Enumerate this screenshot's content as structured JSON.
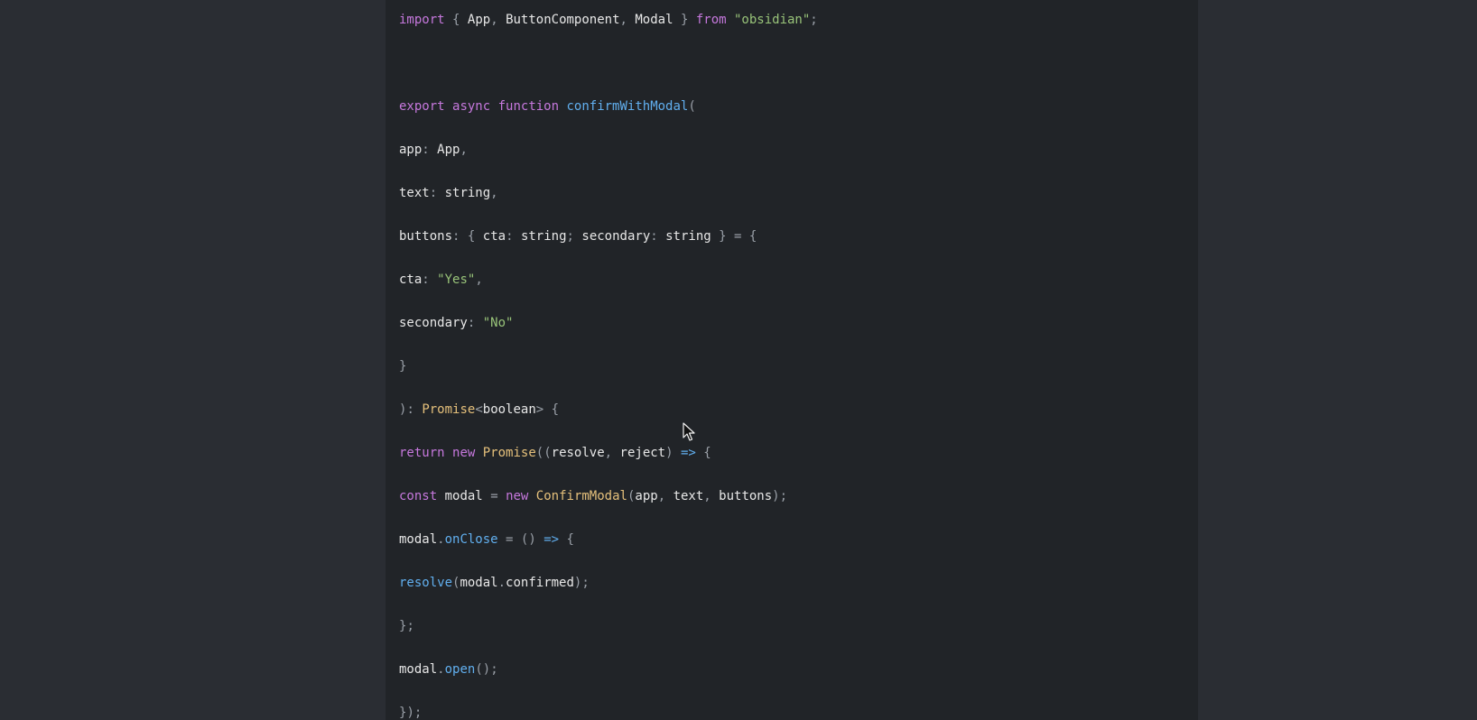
{
  "code": {
    "lines": [
      "import { App, ButtonComponent, Modal } from \"obsidian\";",
      "",
      "export async function confirmWithModal(",
      "app: App,",
      "text: string,",
      "buttons: { cta: string; secondary: string } = {",
      "cta: \"Yes\",",
      "secondary: \"No\"",
      "}",
      "): Promise<boolean> {",
      "return new Promise((resolve, reject) => {",
      "const modal = new ConfirmModal(app, text, buttons);",
      "modal.onClose = () => {",
      "resolve(modal.confirmed);",
      "};",
      "modal.open();",
      "});"
    ]
  },
  "colors": {
    "background": "#2a2d33",
    "panel": "#212428",
    "keyword": "#c678dd",
    "function": "#61afef",
    "string": "#98c379",
    "type": "#e5c07b",
    "punctuation": "#9aa0a8",
    "identifier": "#e8e8e8"
  },
  "icons": {
    "pointer": "mouse-cursor-icon"
  }
}
